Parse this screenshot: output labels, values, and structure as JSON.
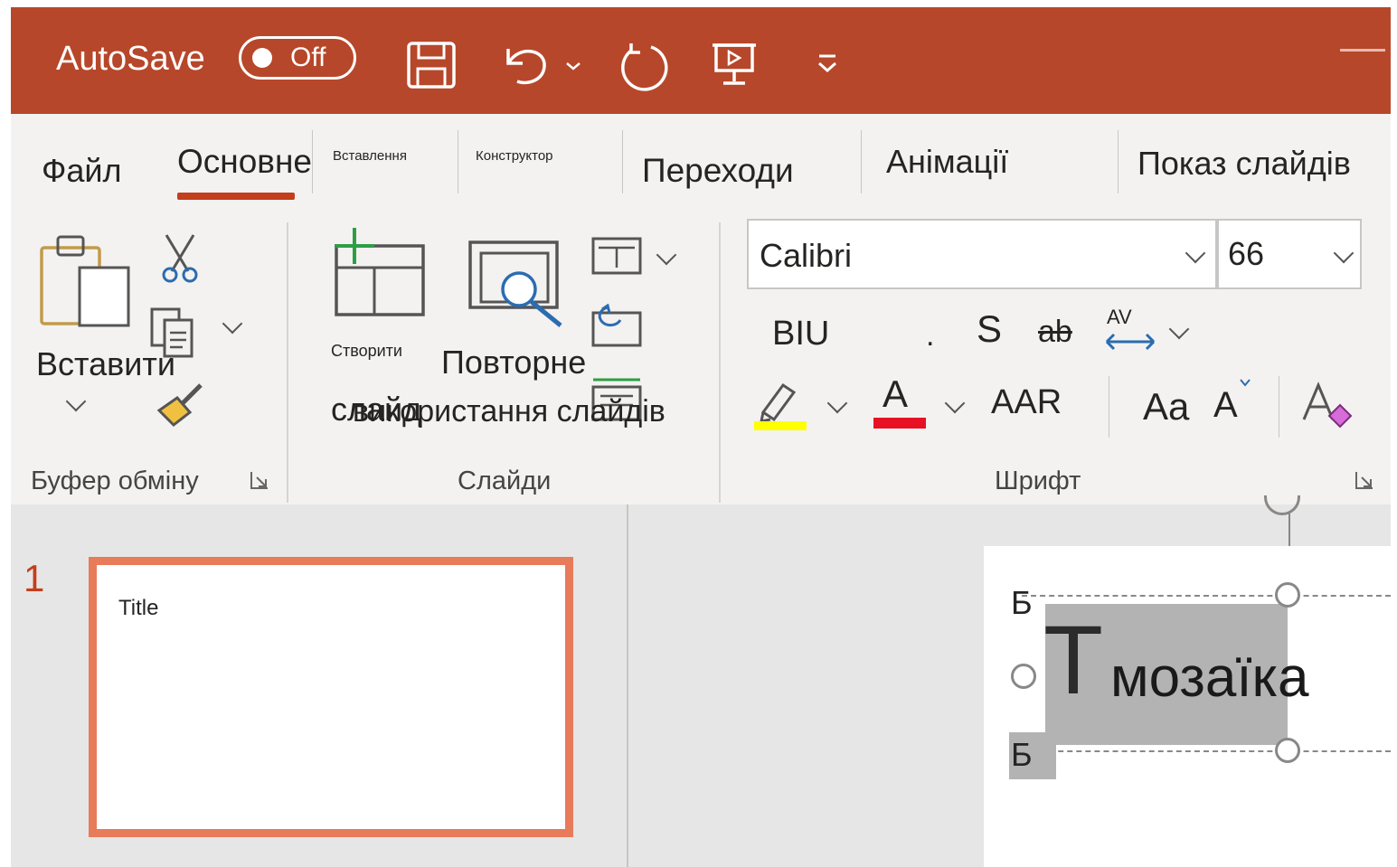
{
  "titlebar": {
    "autosave_label": "AutoSave",
    "autosave_state": "Off",
    "qat_icons": [
      "save-icon",
      "undo-icon",
      "redo-icon",
      "present-icon",
      "customize-qat-icon"
    ]
  },
  "tabs": [
    "Файл",
    "Основне",
    "Вставлення",
    "Конструктор",
    "Переходи",
    "Анімації",
    "Показ слайдів"
  ],
  "active_tab": "Основне",
  "clipboard": {
    "paste_label": "Вставити",
    "group_label": "Буфер обміну"
  },
  "slides_group": {
    "new_slide_top": "Створити",
    "new_slide_bottom": "слайд",
    "reuse_top": "Повторне",
    "reuse_bottom": "використання слайдів",
    "group_label": "Слайди"
  },
  "font_group": {
    "font_name": "Calibri",
    "font_size": "66",
    "bold_italic_underline": "BIU",
    "shadow": "S",
    "strikethrough": "ab",
    "spacing": "AV",
    "dot": ".",
    "font_color_letter": "A",
    "aar": "AAR",
    "change_case": "Aa",
    "grow_font": "A",
    "group_label": "Шрифт",
    "highlight_color": "#ffff00",
    "font_color": "#e81123"
  },
  "left_pane": {
    "slide_number": "1",
    "thumbnail_title": "Title"
  },
  "slide": {
    "marker_top": "Б",
    "marker_bottom": "Б",
    "big_letter": "T",
    "text": "мозаїка"
  },
  "colors": {
    "titlebar": "#b7472a",
    "accent": "#c43e1c",
    "thumb_border": "#e87b5a"
  }
}
